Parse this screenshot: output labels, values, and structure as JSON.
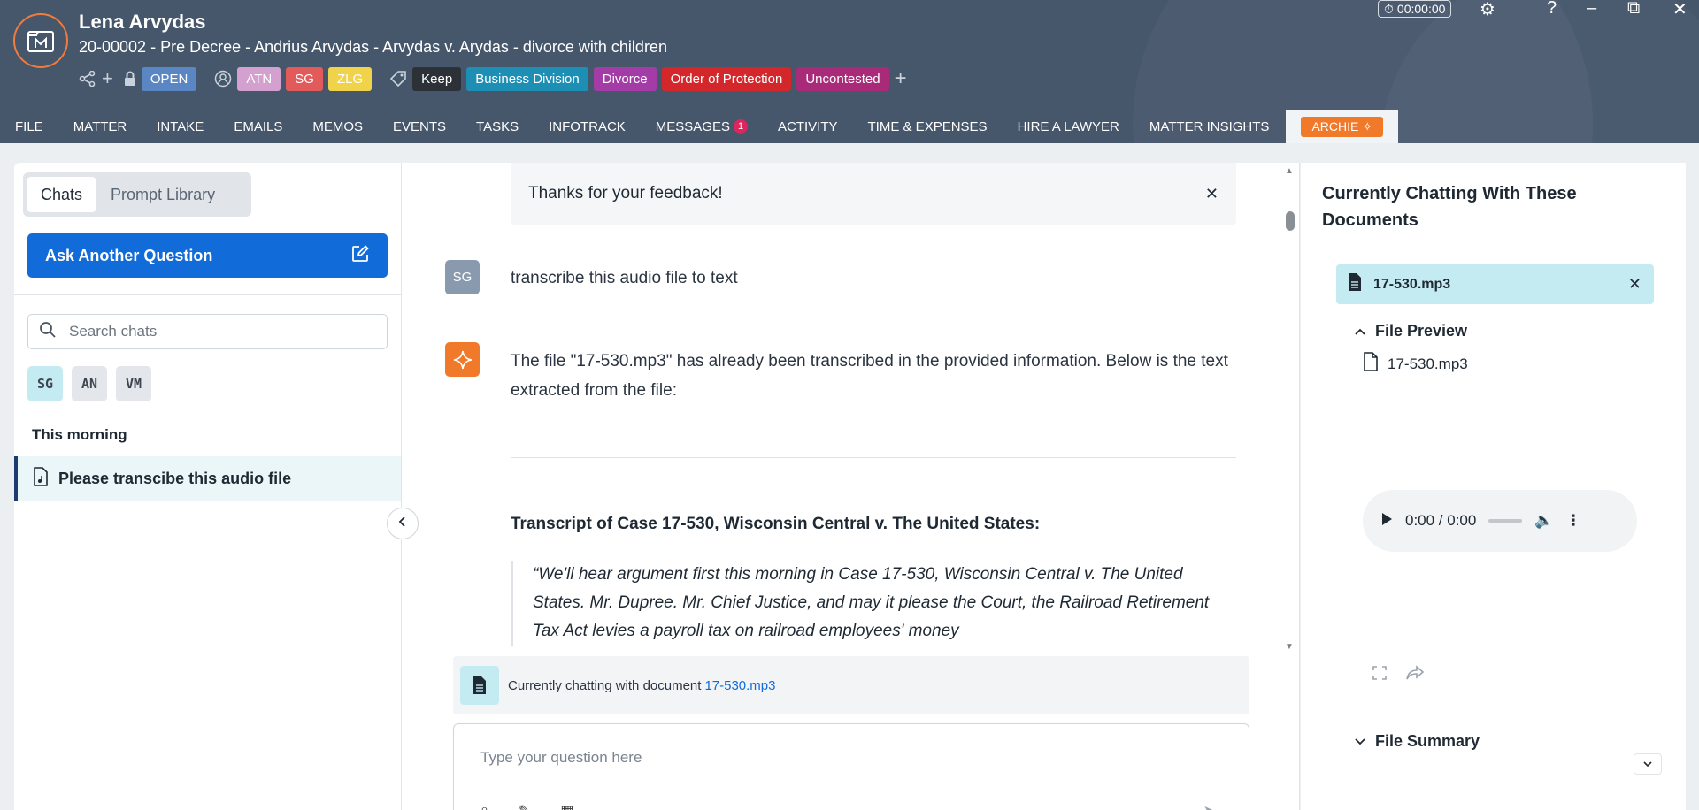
{
  "header": {
    "client_name": "Lena Arvydas",
    "matter_line": "20-00002 - Pre Decree - Andrius Arvydas - Arvydas v. Arydas - divorce with children",
    "status": "OPEN",
    "staff_badges": [
      "ATN",
      "SG",
      "ZLG"
    ],
    "tags": [
      "Keep",
      "Business Division",
      "Divorce",
      "Order of Protection",
      "Uncontested"
    ],
    "timer": "00:00:00",
    "colors": {
      "background": "#46566b",
      "accent": "#f07c3e"
    }
  },
  "nav": {
    "items": [
      "FILE",
      "MATTER",
      "INTAKE",
      "EMAILS",
      "MEMOS",
      "EVENTS",
      "TASKS",
      "INFOTRACK",
      "MESSAGES",
      "ACTIVITY",
      "TIME & EXPENSES",
      "HIRE A LAWYER",
      "MATTER INSIGHTS"
    ],
    "messages_count": "1",
    "archie_label": "ARCHIE"
  },
  "left": {
    "tabs": [
      "Chats",
      "Prompt Library"
    ],
    "active_tab": "Chats",
    "ask_button": "Ask Another Question",
    "search_placeholder": "Search chats",
    "avatars": [
      "SG",
      "AN",
      "VM"
    ],
    "section_label": "This morning",
    "chat_items": [
      "Please transcibe this audio file"
    ]
  },
  "chat": {
    "feedback_text": "Thanks for your feedback!",
    "user_initials": "SG",
    "user_message": "transcribe this audio file to text",
    "bot_message": "The file \"17-530.mp3\" has already been transcribed in the provided information. Below is the text extracted from the file:",
    "transcript_title": "Transcript of Case 17-530, Wisconsin Central v. The United States:",
    "transcript_quote": "“We'll hear argument first this morning in Case 17-530, Wisconsin Central v. The United States. Mr. Dupree. Mr. Chief Justice, and may it please the Court, the Railroad Retirement Tax Act levies a payroll tax on railroad employees' money",
    "doc_bar_prefix": "Currently chatting with document",
    "doc_bar_file": "17-530.mp3",
    "input_placeholder": "Type your question here"
  },
  "right": {
    "title": "Currently Chatting With These Documents",
    "file_chip": "17-530.mp3",
    "preview_label": "File Preview",
    "preview_file": "17-530.mp3",
    "audio_time": "0:00 / 0:00",
    "summary_label": "File Summary"
  }
}
